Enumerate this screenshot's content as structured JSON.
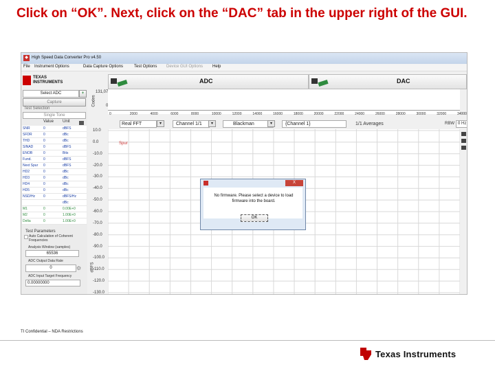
{
  "slide": {
    "title": "Click on “OK”. Next, click on the “DAC” tab in the upper right of the GUI.",
    "footer_note": "TI Confidential – NDA Restrictions",
    "footer_logo_text": "Texas Instruments"
  },
  "app": {
    "window_title": "High Speed Data Converter Pro v4.50",
    "menu": [
      "File",
      "Instrument Options",
      "Data Capture Options",
      "Test Options",
      "Device GUI Options",
      "Help"
    ],
    "logo_line1": "TEXAS",
    "logo_line2": "INSTRUMENTS",
    "tabs": {
      "adc_label": "ADC",
      "dac_label": "DAC"
    }
  },
  "left_panel": {
    "select_adc_label": "Select ADC",
    "capture_button": "Capture",
    "test_selection_label": "Test Selection",
    "test_selection_value": "Single Tone",
    "table_headers": [
      "Value",
      "Unit"
    ],
    "rows": [
      {
        "name": "SNR",
        "value": "0",
        "unit": "dBFS",
        "color": "#1a3fa6"
      },
      {
        "name": "SFDR",
        "value": "0",
        "unit": "dBc",
        "color": "#1a3fa6"
      },
      {
        "name": "THD",
        "value": "0",
        "unit": "dBc",
        "color": "#1a3fa6"
      },
      {
        "name": "SINAD",
        "value": "0",
        "unit": "dBFS",
        "color": "#1a3fa6"
      },
      {
        "name": "ENOB",
        "value": "0",
        "unit": "Bits",
        "color": "#1a3fa6"
      },
      {
        "name": "Fund.",
        "value": "0",
        "unit": "dBFS",
        "color": "#1a3fa6"
      },
      {
        "name": "Next Spur",
        "value": "0",
        "unit": "dBFS",
        "color": "#1a3fa6"
      },
      {
        "name": "HD2",
        "value": "0",
        "unit": "dBc",
        "color": "#1a3fa6"
      },
      {
        "name": "HD3",
        "value": "0",
        "unit": "dBc",
        "color": "#1a3fa6"
      },
      {
        "name": "HD4",
        "value": "0",
        "unit": "dBc",
        "color": "#1a3fa6"
      },
      {
        "name": "HD5",
        "value": "0",
        "unit": "dBc",
        "color": "#1a3fa6"
      },
      {
        "name": "NSD/Hz",
        "value": "0",
        "unit": "dBFS/Hz",
        "color": "#1a3fa6"
      },
      {
        "name": "",
        "value": "",
        "unit": "dBc",
        "color": "#1a3fa6"
      },
      {
        "name": "M1",
        "value": "0",
        "unit": "0.00E+0",
        "color": "#2e8b3e"
      },
      {
        "name": "M2",
        "value": "0",
        "unit": "1.00E+0",
        "color": "#2e8b3e"
      },
      {
        "name": "Delta",
        "value": "0",
        "unit": "1.00E+0",
        "color": "#2e8b3e"
      }
    ],
    "test_parameters_label": "Test Parameters",
    "auto_calc_label": "Auto Calculation of Coherent Frequencies",
    "analysis_window_label": "Analysis Window (samples)",
    "analysis_window_value": "65536",
    "output_rate_label": "ADC Output Data Rate",
    "output_rate_value": "0",
    "input_freq_label": "ADC Input Target Frequency",
    "input_freq_value": "0.00000000"
  },
  "plot_area": {
    "codes_label": "Codes",
    "top_y_ticks": [
      "131,071",
      "0"
    ],
    "top_x_ticks": [
      "0",
      "2000",
      "4000",
      "6000",
      "8000",
      "10000",
      "12000",
      "14000",
      "16000",
      "18000",
      "20000",
      "22000",
      "24000",
      "26000",
      "28000",
      "30000",
      "32000",
      "34000"
    ],
    "controls": {
      "fft_type": "Real FFT",
      "channel": "Channel 1/1",
      "window": "Blackman",
      "channel_display": "{Channel 1}",
      "averages": "1/1 Averages",
      "rbw_label": "RBW",
      "rbw_value": "0",
      "hz_label": "Hz"
    },
    "y_ticks": [
      "10.0",
      "0.0",
      "-10.0",
      "-20.0",
      "-30.0",
      "-40.0",
      "-50.0",
      "-60.0",
      "-70.0",
      "-80.0",
      "-90.0",
      "-100.0",
      "-110.0",
      "-120.0",
      "-130.0"
    ],
    "dbfs_label": "dBFS",
    "spur_label": "Spur"
  },
  "dialog": {
    "message": "No firmware. Please select a device to load firmware into the board.",
    "ok_label": "OK",
    "close_glyph": "X"
  },
  "colors": {
    "title_red": "#cc0000",
    "ti_red": "#c00000",
    "grid": "#d8d8d8"
  }
}
